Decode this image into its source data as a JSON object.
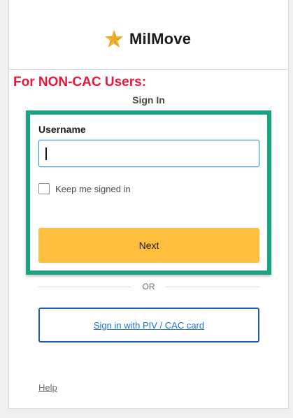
{
  "header": {
    "app_name": "MilMove",
    "logo_icon": "star-logo-icon",
    "brand_color": "#F5B935"
  },
  "annotation": {
    "text": "For NON-CAC Users:",
    "color": "#E6183D",
    "highlight_color": "#1AA383"
  },
  "form": {
    "heading": "Sign In",
    "username_label": "Username",
    "username_value": "",
    "keep_signed_in_label": "Keep me signed in",
    "keep_signed_in_checked": false,
    "next_label": "Next"
  },
  "divider": {
    "or_label": "OR"
  },
  "piv": {
    "label": "Sign in with PIV / CAC card"
  },
  "footer": {
    "help_label": "Help"
  }
}
